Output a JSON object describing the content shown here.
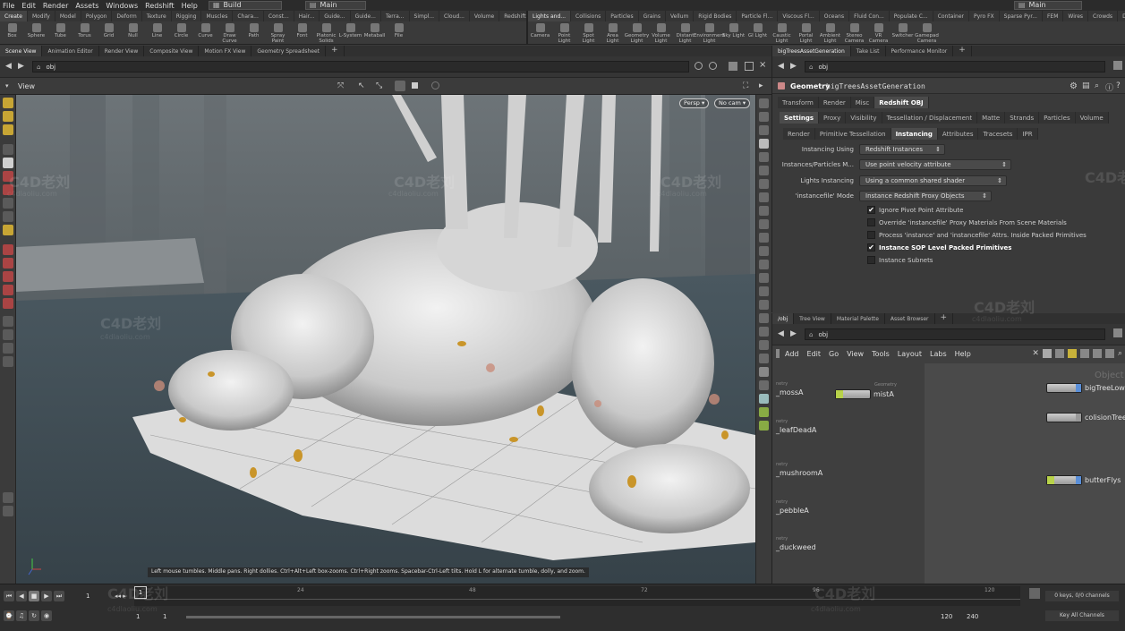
{
  "menubar": {
    "items": [
      "File",
      "Edit",
      "Render",
      "Assets",
      "Windows",
      "Redshift",
      "Help"
    ],
    "build_label": "Build",
    "main_label": "Main",
    "main_right_label": "Main"
  },
  "shelf_tabs_left": [
    "Create",
    "Modify",
    "Model",
    "Polygon",
    "Deform",
    "Texture",
    "Rigging",
    "Muscles",
    "Chara...",
    "Const...",
    "Hair...",
    "Guide...",
    "Guide...",
    "Terra...",
    "Simpl...",
    "Cloud...",
    "Volume",
    "Redshift"
  ],
  "shelf_tabs_right": [
    "Lights and...",
    "Collisions",
    "Particles",
    "Grains",
    "Vellum",
    "Rigid Bodies",
    "Particle Fl...",
    "Viscous Fl...",
    "Oceans",
    "Fluid Con...",
    "Populate C...",
    "Container",
    "Pyro FX",
    "Sparse Pyr...",
    "FEM",
    "Wires",
    "Crowds",
    "Drive Sim..."
  ],
  "shelf_tools_left": [
    "Box",
    "Sphere",
    "Tube",
    "Torus",
    "Grid",
    "Null",
    "Line",
    "Circle",
    "Curve",
    "Draw Curve",
    "Path",
    "Spray Paint",
    "Font",
    "Platonic Solids",
    "L-System",
    "Metaball",
    "File"
  ],
  "shelf_tools_right": [
    "Camera",
    "Point Light",
    "Spot Light",
    "Area Light",
    "Geometry Light",
    "Volume Light",
    "Distant Light",
    "Environment Light",
    "Sky Light",
    "GI Light",
    "Caustic Light",
    "Portal Light",
    "Ambient Light",
    "Stereo Camera",
    "VR Camera",
    "Switcher",
    "Gamepad Camera"
  ],
  "left_panel_tabs": [
    "Scene View",
    "Animation Editor",
    "Render View",
    "Composite View",
    "Motion FX View",
    "Geometry Spreadsheet"
  ],
  "right_panel_tabs": [
    "bigTreesAssetGeneration",
    "Take List",
    "Performance Monitor"
  ],
  "path": {
    "left": "obj",
    "right": "obj",
    "network": "obj"
  },
  "viewport": {
    "label": "View",
    "persp_button": "Persp",
    "cam_button": "No cam",
    "hint": "Left mouse tumbles. Middle pans. Right dollies. Ctrl+Alt+Left box-zooms. Ctrl+Right zooms. Spacebar-Ctrl-Left tilts. Hold L for alternate tumble, dolly, and zoom."
  },
  "params": {
    "node_type": "Geometry",
    "node_name": "bigTreesAssetGeneration",
    "tabs_row1": [
      "Transform",
      "Render",
      "Misc",
      "Redshift OBJ"
    ],
    "tabs_row2": [
      "Settings",
      "Proxy",
      "Visibility",
      "Tessellation / Displacement",
      "Matte",
      "Strands",
      "Particles",
      "Volume"
    ],
    "tabs_row3": [
      "Render",
      "Primitive Tessellation",
      "Instancing",
      "Attributes",
      "Tracesets",
      "IPR"
    ],
    "menus": [
      {
        "label": "Instancing Using",
        "value": "Redshift Instances"
      },
      {
        "label": "Instances/Particles M...",
        "value": "Use point velocity attribute"
      },
      {
        "label": "Lights Instancing",
        "value": "Using a common shared shader"
      },
      {
        "label": "'instancefile' Mode",
        "value": "Instance Redshift Proxy Objects"
      }
    ],
    "checks": [
      {
        "label": "Ignore Pivot Point Attribute",
        "checked": true
      },
      {
        "label": "Override 'instancefile' Proxy Materials From Scene Materials",
        "checked": false
      },
      {
        "label": "Process 'instance' and 'instancefile' Attrs. Inside Packed Primitives",
        "checked": false
      },
      {
        "label": "Instance SOP Level Packed Primitives",
        "checked": true
      },
      {
        "label": "Instance Subnets",
        "checked": false
      }
    ]
  },
  "network": {
    "tabs": [
      "/obj",
      "Tree View",
      "Material Palette",
      "Asset Browser"
    ],
    "menu": [
      "Add",
      "Edit",
      "Go",
      "View",
      "Tools",
      "Layout",
      "Labs",
      "Help"
    ],
    "list_prefix": "netry",
    "list": [
      "_mossA",
      "_leafDeadA",
      "_mushroomA",
      "_pebbleA",
      "_duckweed"
    ],
    "nodes_left": [
      {
        "label": "mistA",
        "tag": "Geometry"
      }
    ],
    "nodes_right": [
      "bigTreeLow",
      "colisionTree",
      "butterFlys"
    ],
    "partial_label": "Object"
  },
  "timeline": {
    "frame": "1",
    "ticks": [
      "1",
      "24",
      "48",
      "72",
      "96",
      "120"
    ],
    "start": "1",
    "start2": "1",
    "end": "120",
    "end2": "240",
    "keys_info": "0 keys, 0/0 channels",
    "key_all": "Key All Channels"
  },
  "watermark": {
    "main": "C4D老刘",
    "url": "c4dlaoliu.com"
  },
  "colors": {
    "node_green": "#b8d24a",
    "node_blue": "#5a8fd8",
    "accent": "#e8c23a"
  }
}
